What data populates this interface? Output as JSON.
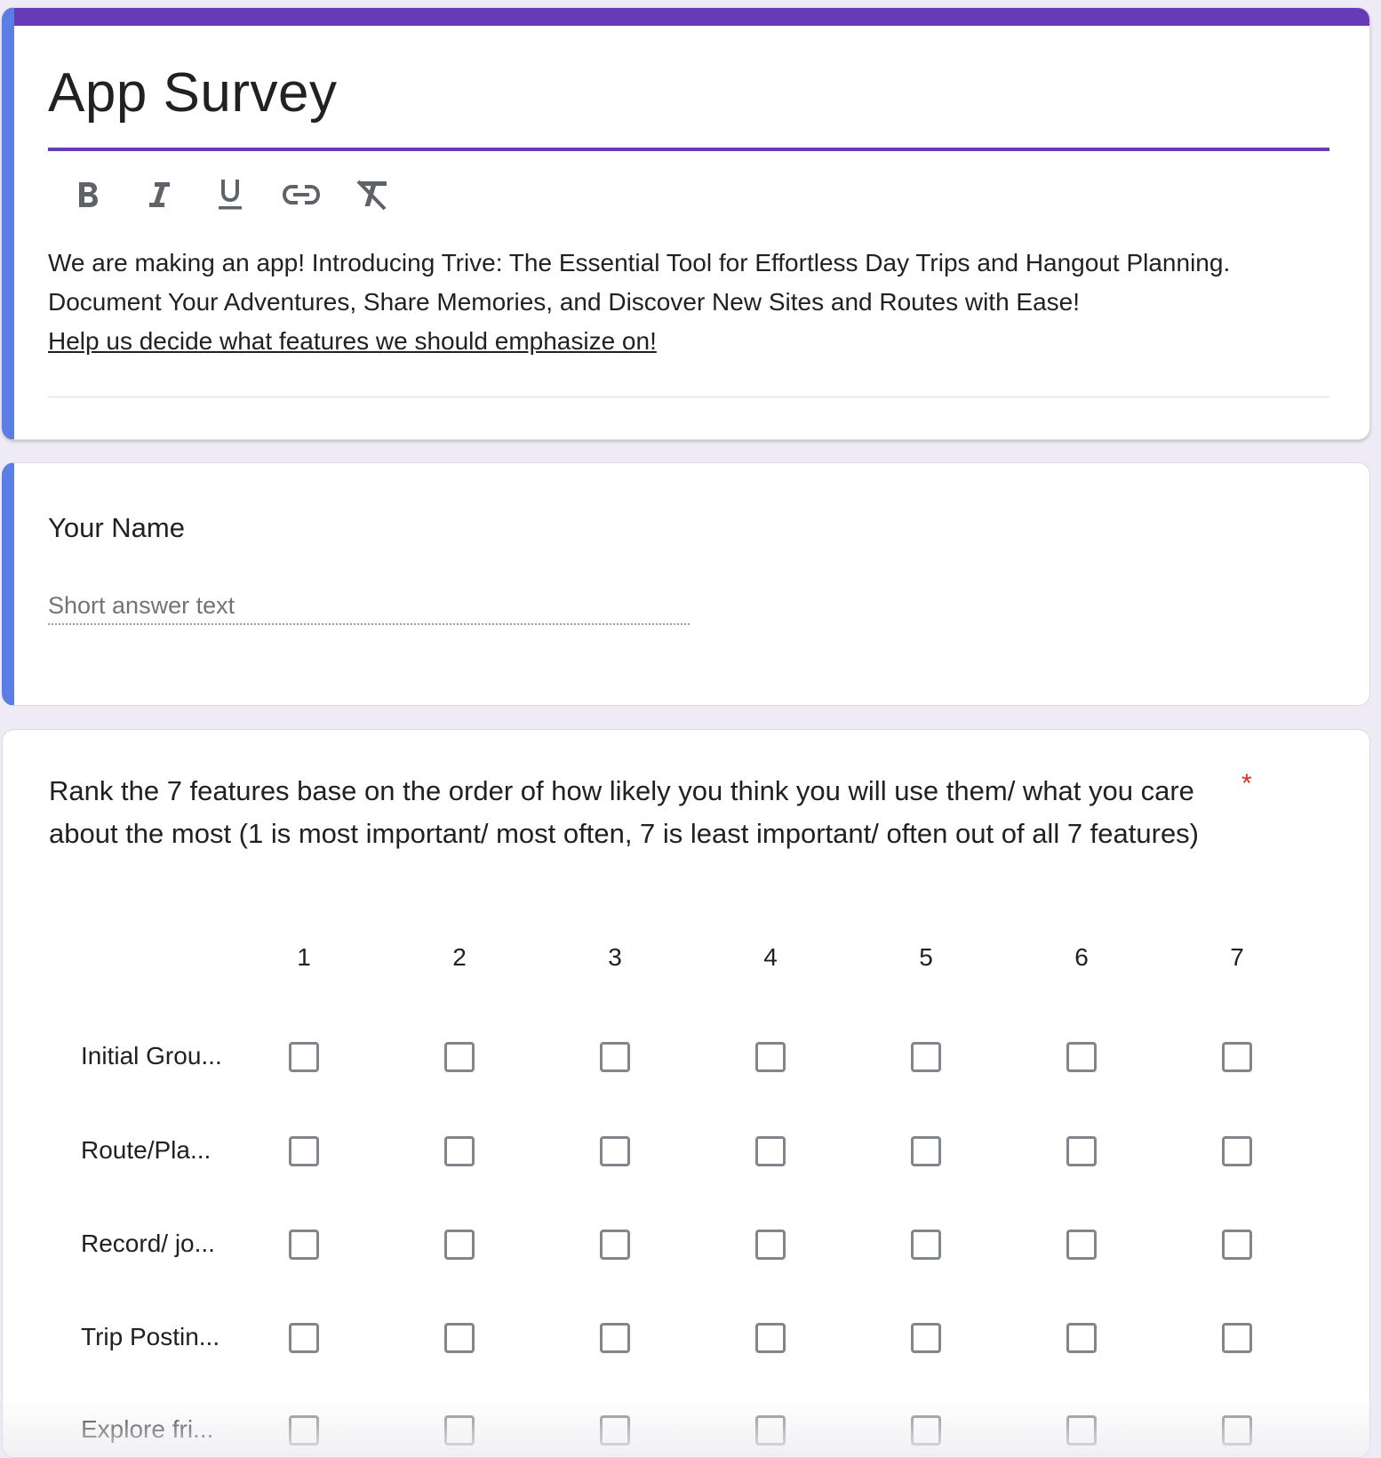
{
  "form": {
    "title": "App Survey",
    "toolbar": [
      {
        "name": "bold-icon",
        "label": "B"
      },
      {
        "name": "italic-icon",
        "label": "I"
      },
      {
        "name": "underline-icon",
        "label": "U"
      },
      {
        "name": "link-icon",
        "label": ""
      },
      {
        "name": "clear-formatting-icon",
        "label": ""
      }
    ],
    "description": {
      "line1": "We are making an app! Introducing Trive: The Essential Tool for Effortless Day Trips and Hangout Planning.",
      "line2": "Document Your Adventures, Share Memories, and Discover New Sites and Routes with Ease!",
      "link": "Help us decide what features we should emphasize on!"
    },
    "accent_color": "#673ab7",
    "focus_color": "#5b7de6",
    "background_color": "#efebf6"
  },
  "name_question": {
    "title": "Your Name",
    "placeholder": "Short answer text"
  },
  "grid_question": {
    "title": "Rank the 7 features base on the order of how likely you think you will use them/ what you care about the most (1 is most important/ most often, 7 is least important/ often out of all 7 features)",
    "required_mark": "*",
    "columns": [
      "1",
      "2",
      "3",
      "4",
      "5",
      "6",
      "7"
    ],
    "rows": [
      "Initial Grou...",
      "Route/Pla...",
      "Record/ jo...",
      "Trip Postin...",
      "Explore fri..."
    ]
  }
}
